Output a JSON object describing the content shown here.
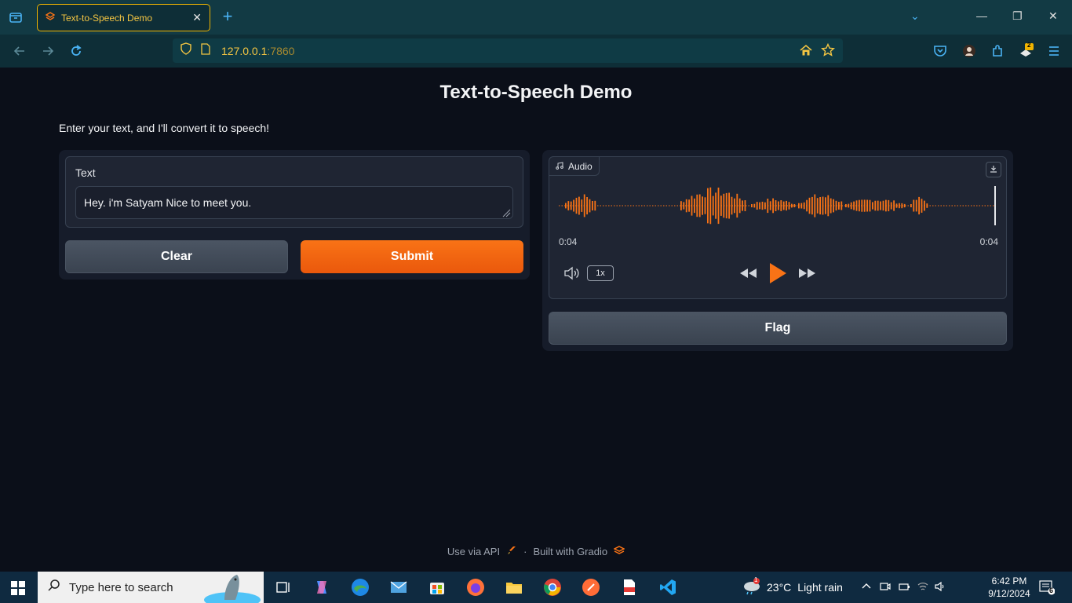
{
  "browser": {
    "tab_title": "Text-to-Speech Demo",
    "url_host": "127.0.0.1",
    "url_port": ":7860",
    "extension_badge": "2"
  },
  "page": {
    "title": "Text-to-Speech Demo",
    "description": "Enter your text, and I'll convert it to speech!"
  },
  "input": {
    "label": "Text",
    "value": "Hey. i'm Satyam Nice to meet you."
  },
  "buttons": {
    "clear": "Clear",
    "submit": "Submit",
    "flag": "Flag"
  },
  "audio": {
    "label": "Audio",
    "current_time": "0:04",
    "duration": "0:04",
    "playback_rate": "1x",
    "progress": 1.0
  },
  "footer": {
    "api": "Use via API",
    "separator": "·",
    "built_with": "Built with Gradio"
  },
  "taskbar": {
    "search_placeholder": "Type here to search",
    "temperature": "23°C",
    "weather": "Light rain",
    "weather_badge": "1",
    "time": "6:42 PM",
    "date": "9/12/2024",
    "notifications": "6"
  },
  "colors": {
    "accent": "#f97316",
    "background": "#0b0f19",
    "browser_chrome": "#123a44"
  }
}
